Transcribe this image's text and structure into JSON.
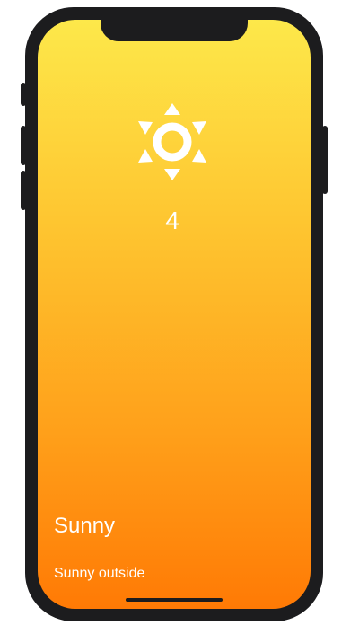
{
  "weather": {
    "icon": "sun-icon",
    "temperature": "4",
    "condition": "Sunny",
    "description": "Sunny outside"
  },
  "colors": {
    "gradient_top": "#fde84a",
    "gradient_bottom": "#ff7a05",
    "text": "#ffffff",
    "frame": "#1c1c1e"
  }
}
